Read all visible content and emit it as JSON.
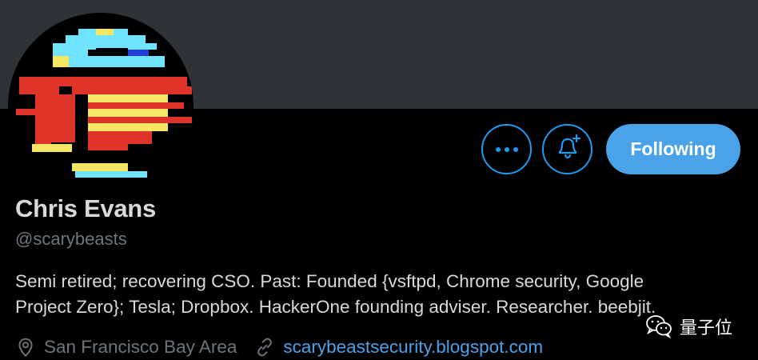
{
  "profile": {
    "name": "Chris Evans",
    "handle": "@scarybeasts",
    "bio_line1": "Semi retired; recovering CSO. Past: Founded {vsftpd, Chrome security, Google",
    "bio_line2": "Project Zero}; Tesla; Dropbox. HackerOne founding adviser. Researcher. beebjit.",
    "location": "San Francisco Bay Area",
    "website": "scarybeastsecurity.blogspot.com"
  },
  "actions": {
    "more_icon": "more-horizontal-icon",
    "bell_icon": "notification-bell-plus-icon",
    "following_label": "Following"
  },
  "watermark": {
    "text": "量子位",
    "icon": "wechat-icon"
  },
  "colors": {
    "banner": "#2f3336",
    "background": "#000000",
    "accent": "#1d9bf0",
    "following_button": "#4aa3e8",
    "secondary_text": "#6e767d",
    "primary_text": "#d9d9d9"
  }
}
